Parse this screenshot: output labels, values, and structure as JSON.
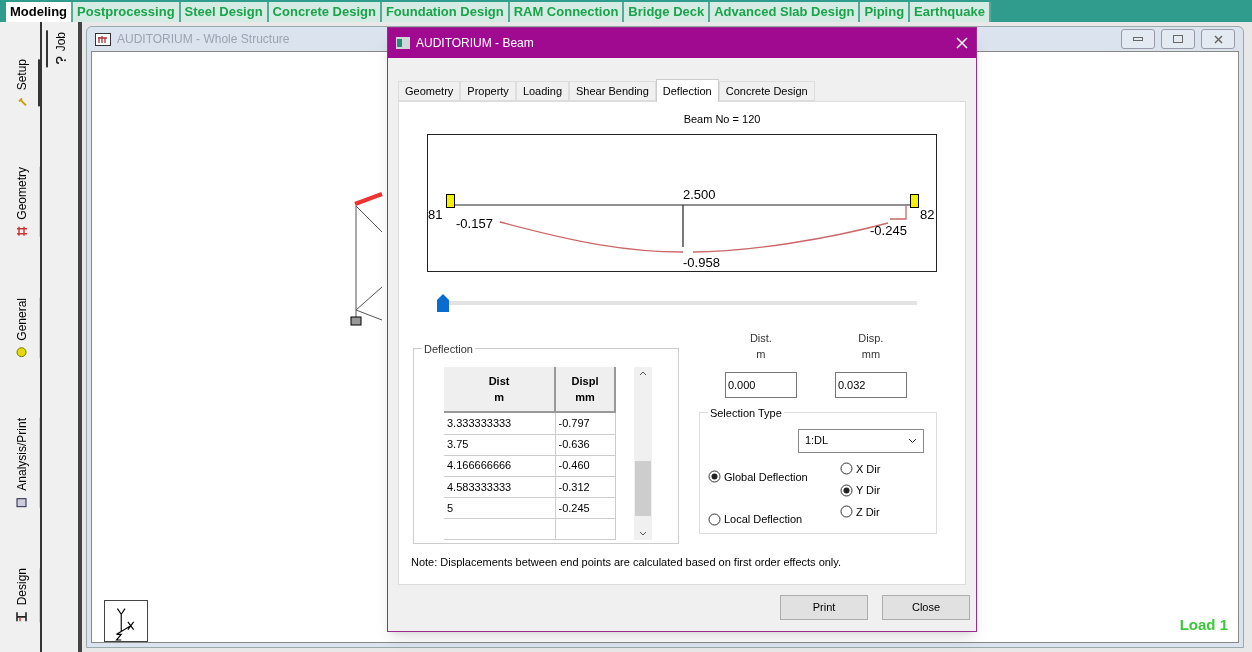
{
  "top_tabs": [
    {
      "label": "Modeling",
      "selected": true
    },
    {
      "label": "Postprocessing",
      "selected": false
    },
    {
      "label": "Steel Design",
      "selected": false
    },
    {
      "label": "Concrete Design",
      "selected": false
    },
    {
      "label": "Foundation Design",
      "selected": false
    },
    {
      "label": "RAM Connection",
      "selected": false
    },
    {
      "label": "Bridge Deck",
      "selected": false
    },
    {
      "label": "Advanced Slab Design",
      "selected": false
    },
    {
      "label": "Piping",
      "selected": false
    },
    {
      "label": "Earthquake",
      "selected": false
    }
  ],
  "side_tabs": [
    {
      "label": "Setup",
      "selected": true,
      "kind": "setup"
    },
    {
      "label": "Geometry",
      "selected": false,
      "kind": "geometry"
    },
    {
      "label": "General",
      "selected": false,
      "kind": "general"
    },
    {
      "label": "Analysis/Print",
      "selected": false,
      "kind": "analysis"
    },
    {
      "label": "Design",
      "selected": false,
      "kind": "design"
    }
  ],
  "job_tab": {
    "label": "Job"
  },
  "structure_window": {
    "title": "AUDITORIUM - Whole Structure",
    "load_label": "Load 1"
  },
  "dialog": {
    "title": "AUDITORIUM - Beam",
    "tabs": [
      {
        "label": "Geometry",
        "selected": false
      },
      {
        "label": "Property",
        "selected": false
      },
      {
        "label": "Loading",
        "selected": false
      },
      {
        "label": "Shear Bending",
        "selected": false
      },
      {
        "label": "Deflection",
        "selected": true
      },
      {
        "label": "Concrete Design",
        "selected": false
      }
    ],
    "beam_label": "Beam No = 120",
    "diagram": {
      "start_node": "81",
      "end_node": "82",
      "mid_distance": "2.500",
      "start_value": "-0.157",
      "mid_value": "-0.958",
      "end_value": "-0.245"
    },
    "slider": {
      "level": 0
    },
    "group_title": "Deflection",
    "table": {
      "columns": [
        {
          "heading": "Dist",
          "unit": "m"
        },
        {
          "heading": "Displ",
          "unit": "mm"
        }
      ],
      "rows": [
        [
          "3.333333333",
          "-0.797"
        ],
        [
          "3.75",
          "-0.636"
        ],
        [
          "4.166666666",
          "-0.460"
        ],
        [
          "4.583333333",
          "-0.312"
        ],
        [
          "5",
          "-0.245"
        ]
      ]
    },
    "fields": [
      {
        "heading": "Dist.",
        "unit": "m",
        "value": "0.000"
      },
      {
        "heading": "Disp.",
        "unit": "mm",
        "value": "0.032"
      }
    ],
    "selection_type": {
      "title": "Selection Type",
      "load_case": "1:DL",
      "modes": [
        {
          "label": "Global Deflection",
          "selected": true
        },
        {
          "label": "Local Deflection",
          "selected": false
        }
      ],
      "directions": [
        {
          "label": "X Dir",
          "selected": false
        },
        {
          "label": "Y Dir",
          "selected": true
        },
        {
          "label": "Z Dir",
          "selected": false
        }
      ]
    },
    "note": "Note: Displacements between end points are calculated based on first order effects only.",
    "buttons": [
      "Print",
      "Close"
    ]
  }
}
